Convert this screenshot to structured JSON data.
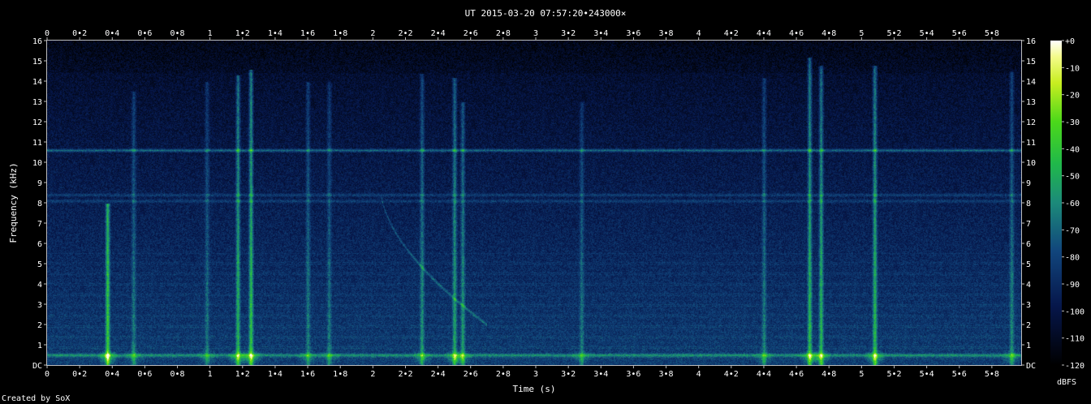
{
  "chart_data": {
    "type": "heatmap",
    "title": "UT 2015-03-20 07:57:20•243000×",
    "xlabel": "Time (s)",
    "ylabel": "Frequency (kHz)",
    "xlim": [
      0,
      5.98
    ],
    "ylim": [
      0,
      16
    ],
    "x_ticks": [
      "0",
      "0•2",
      "0•4",
      "0•6",
      "0•8",
      "1",
      "1•2",
      "1•4",
      "1•6",
      "1•8",
      "2",
      "2•2",
      "2•4",
      "2•6",
      "2•8",
      "3",
      "3•2",
      "3•4",
      "3•6",
      "3•8",
      "4",
      "4•2",
      "4•4",
      "4•6",
      "4•8",
      "5",
      "5•2",
      "5•4",
      "5•6",
      "5•8"
    ],
    "y_ticks": [
      "DC",
      "1",
      "2",
      "3",
      "4",
      "5",
      "6",
      "7",
      "8",
      "9",
      "10",
      "11",
      "12",
      "13",
      "14",
      "15",
      "16"
    ],
    "colorbar": {
      "label": "dBFS",
      "ticks": [
        "+0",
        "-10",
        "-20",
        "-30",
        "-40",
        "-50",
        "-60",
        "-70",
        "-80",
        "-90",
        "-100",
        "-110",
        "-120"
      ],
      "range": [
        -120,
        0
      ]
    },
    "features": {
      "tone_lines_khz": [
        10.6,
        8.4,
        8.1,
        0.5
      ],
      "impulses": [
        {
          "t": 0.37,
          "top_khz": 8.0,
          "level": 1.0
        },
        {
          "t": 0.53,
          "top_khz": 13.5,
          "level": 0.45
        },
        {
          "t": 0.98,
          "top_khz": 14.0,
          "level": 0.4
        },
        {
          "t": 1.17,
          "top_khz": 14.3,
          "level": 0.8
        },
        {
          "t": 1.25,
          "top_khz": 14.6,
          "level": 0.9
        },
        {
          "t": 1.6,
          "top_khz": 14.0,
          "level": 0.45
        },
        {
          "t": 1.73,
          "top_khz": 14.0,
          "level": 0.4
        },
        {
          "t": 2.3,
          "top_khz": 14.4,
          "level": 0.55
        },
        {
          "t": 2.5,
          "top_khz": 14.2,
          "level": 0.7
        },
        {
          "t": 2.55,
          "top_khz": 13.0,
          "level": 0.6
        },
        {
          "t": 3.28,
          "top_khz": 13.0,
          "level": 0.4
        },
        {
          "t": 4.4,
          "top_khz": 14.2,
          "level": 0.45
        },
        {
          "t": 4.68,
          "top_khz": 15.2,
          "level": 0.85
        },
        {
          "t": 4.75,
          "top_khz": 14.8,
          "level": 0.8
        },
        {
          "t": 5.08,
          "top_khz": 14.8,
          "level": 0.85
        },
        {
          "t": 5.92,
          "top_khz": 14.5,
          "level": 0.5
        }
      ],
      "sweep": {
        "t_start": 2.05,
        "khz_start": 8.5,
        "t_end": 2.7,
        "khz_end": 2.0
      }
    }
  },
  "footer": {
    "credit": "Created by SoX"
  }
}
